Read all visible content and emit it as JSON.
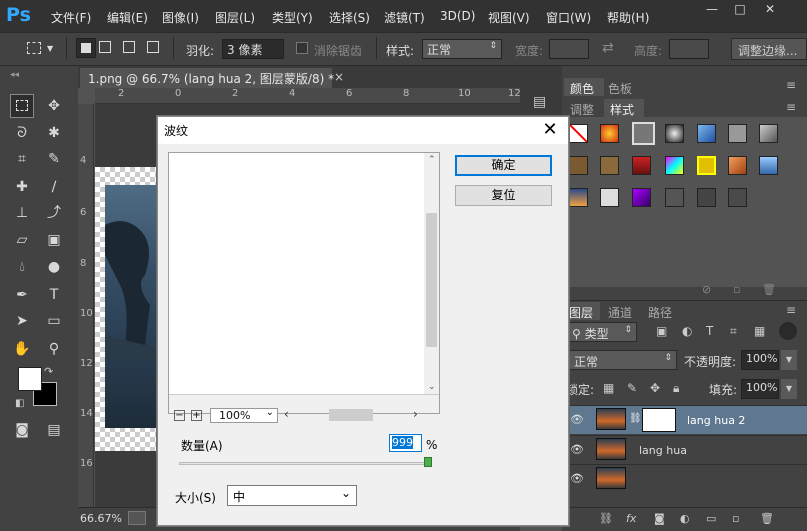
{
  "app": {
    "logo": "Ps"
  },
  "menu": [
    "文件(F)",
    "编辑(E)",
    "图像(I)",
    "图层(L)",
    "类型(Y)",
    "选择(S)",
    "滤镜(T)",
    "3D(D)",
    "视图(V)",
    "窗口(W)",
    "帮助(H)"
  ],
  "window_controls": {
    "minimize": "—",
    "maximize": "□",
    "close": "✕"
  },
  "options": {
    "feather_label": "羽化:",
    "feather_value": "3 像素",
    "antialias_label": "消除锯齿",
    "style_label": "样式:",
    "style_value": "正常",
    "width_label": "宽度:",
    "height_label": "高度:",
    "refine_edge": "调整边缘..."
  },
  "document": {
    "tab_title": "1.png @ 66.7% (lang hua 2, 图层蒙版/8) *",
    "close": "×",
    "zoom": "66.67%"
  },
  "ruler": {
    "top": [
      "2",
      "0",
      "2",
      "4",
      "6",
      "8",
      "10",
      "12"
    ],
    "left": [
      "4",
      "6",
      "8",
      "10",
      "12",
      "14",
      "16",
      "18",
      "20"
    ]
  },
  "dialog": {
    "title": "波纹",
    "ok": "确定",
    "reset": "复位",
    "zoom": "100%",
    "amount_label": "数量(A)",
    "amount_value": "999",
    "amount_unit": "%",
    "size_label": "大小(S)",
    "size_value": "中",
    "amount_fraction": 1.0
  },
  "right_panel": {
    "tabs_top": [
      "颜色",
      "色板"
    ],
    "tabs_mid": [
      "调整",
      "样式"
    ],
    "tabs_layers": [
      "图层",
      "通道",
      "路径"
    ],
    "filter_kind": "类型",
    "blend_mode": "正常",
    "opacity_label": "不透明度:",
    "opacity_value": "100%",
    "lock_label": "锁定:",
    "fill_label": "填充:",
    "fill_value": "100%"
  },
  "layers": [
    {
      "name": "lang hua 2",
      "selected": true,
      "has_mask": true
    },
    {
      "name": "lang hua",
      "selected": false,
      "has_mask": false
    },
    {
      "name": "",
      "selected": false,
      "has_mask": false
    }
  ],
  "colors": {
    "bg": "#535353",
    "menubar": "#323232",
    "panel": "#424242",
    "accent": "#31a8ff",
    "selected_layer": "#5f7890",
    "ok_border": "#0078d7"
  }
}
